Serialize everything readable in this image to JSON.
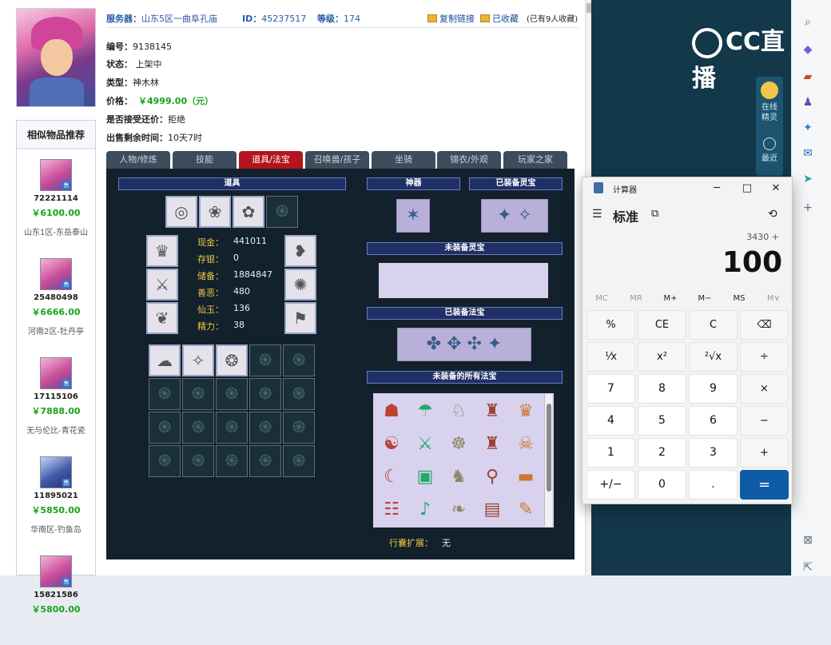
{
  "header": {
    "server_label": "服务器：",
    "server_value": "山东5区一曲阜孔庙",
    "id_label": "ID：",
    "id_value": "45237517",
    "level_label": "等级：",
    "level_value": "174",
    "copy_link": "复制链接",
    "favorited": "已收藏",
    "fav_count": "(已有9人收藏)"
  },
  "info": {
    "number_label": "编号：",
    "number_value": "9138145",
    "status_label": "状态：",
    "status_value": "上架中",
    "type_label": "类型：",
    "type_value": "神木林",
    "price_label": "价格：",
    "price_value": "￥4999.00（元）",
    "bargain_label": "是否接受还价：",
    "bargain_value": "拒绝",
    "remain_label": "出售剩余时间：",
    "remain_value": "10天7时"
  },
  "tabs": [
    "人物/修炼",
    "技能",
    "道具/法宝",
    "召唤兽/孩子",
    "坐骑",
    "锦衣/外观",
    "玩家之家"
  ],
  "active_tab": 2,
  "sidebar": {
    "title": "相似物品推荐",
    "items": [
      {
        "id": "72221114",
        "price": "￥6100.00",
        "server": "山东1区-东岳泰山",
        "avatar": "girl"
      },
      {
        "id": "25480498",
        "price": "￥6666.00",
        "server": "河南2区-牡丹亭",
        "avatar": "girl"
      },
      {
        "id": "17115106",
        "price": "￥7888.00",
        "server": "无与伦比-青花瓷",
        "avatar": "girl"
      },
      {
        "id": "11895021",
        "price": "￥5850.00",
        "server": "华南区-钓鱼岛",
        "avatar": "boy"
      },
      {
        "id": "15821586",
        "price": "￥5800.00",
        "server": "",
        "avatar": "girl"
      }
    ]
  },
  "game": {
    "sections": {
      "items": "道具",
      "artifact": "神器",
      "equipped_lingbao": "已装备灵宝",
      "unequipped_lingbao": "未装备灵宝",
      "equipped_fabao": "已装备法宝",
      "unequipped_fabao": "未装备的所有法宝"
    },
    "stats": [
      {
        "label": "现金：",
        "value": "441011"
      },
      {
        "label": "存银：",
        "value": "0"
      },
      {
        "label": "储备：",
        "value": "1884847"
      },
      {
        "label": "善恶：",
        "value": "480"
      },
      {
        "label": "仙玉：",
        "value": "136"
      },
      {
        "label": "精力：",
        "value": "38"
      }
    ],
    "xingnang_label": "行囊扩展：",
    "xingnang_value": "无"
  },
  "calculator": {
    "title": "计算器",
    "mode": "标准",
    "expression": "3430 +",
    "display": "100",
    "memory": [
      "MC",
      "MR",
      "M+",
      "M−",
      "MS",
      "M∨"
    ],
    "keys": [
      [
        "%",
        "CE",
        "C",
        "⌫"
      ],
      [
        "¹⁄x",
        "x²",
        "²√x",
        "÷"
      ],
      [
        "7",
        "8",
        "9",
        "×"
      ],
      [
        "4",
        "5",
        "6",
        "−"
      ],
      [
        "1",
        "2",
        "3",
        "+"
      ],
      [
        "+/−",
        "0",
        ".",
        "="
      ]
    ]
  },
  "right_panel": {
    "logo_text": "CC直播",
    "widget_label_1": "在线",
    "widget_label_2": "精灵",
    "widget_label_3": "最近"
  },
  "colors": {
    "price_green": "#16a316",
    "tab_active": "#b4141e",
    "calc_equal": "#0f5ba6"
  }
}
